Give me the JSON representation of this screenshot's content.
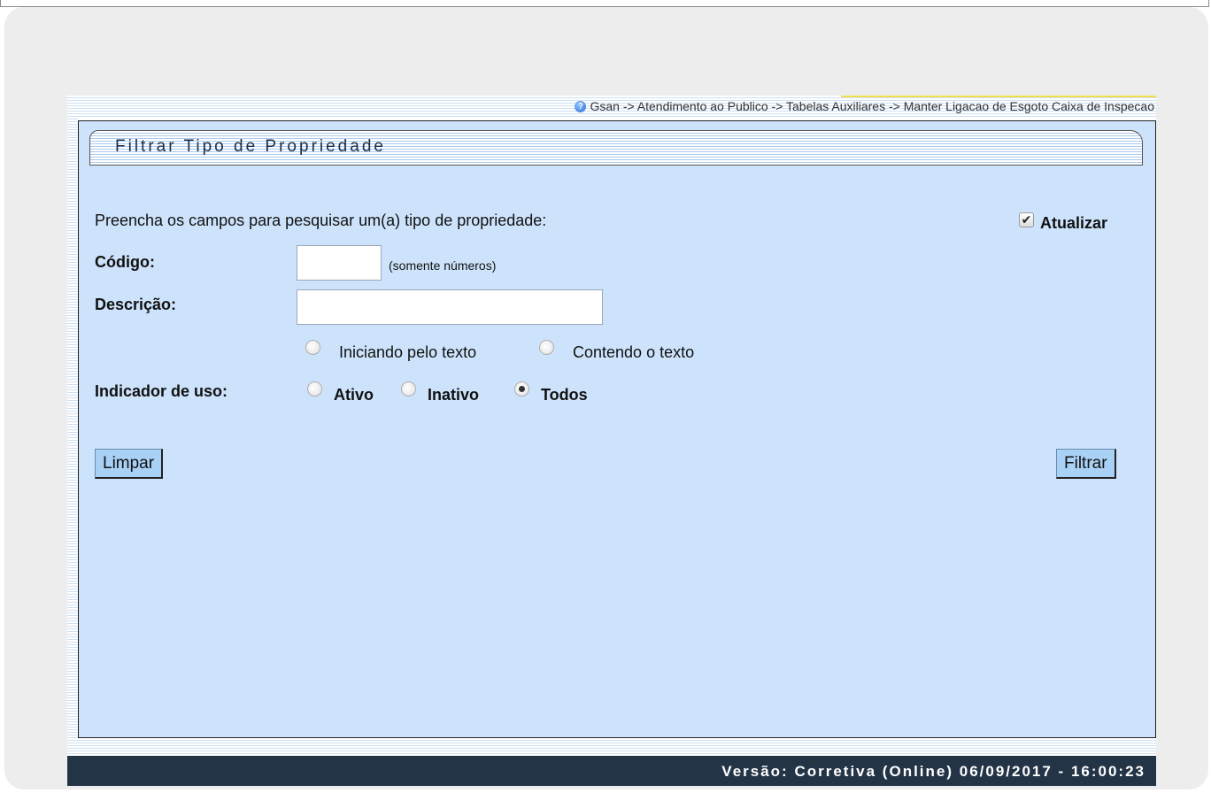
{
  "breadcrumb": "Gsan -> Atendimento ao Publico -> Tabelas Auxiliares -> Manter Ligacao de Esgoto Caixa de Inspecao",
  "page_title": "Filtrar Tipo de Propriedade",
  "instructions": "Preencha os campos para pesquisar um(a) tipo de propriedade:",
  "atualizar": {
    "label": "Atualizar",
    "checked": true
  },
  "codigo": {
    "label": "Código:",
    "value": "",
    "hint": "(somente números)"
  },
  "descricao": {
    "label": "Descrição:",
    "value": "",
    "options": [
      "Iniciando pelo texto",
      "Contendo o texto"
    ]
  },
  "indicador_uso": {
    "label": "Indicador de uso:",
    "options": [
      "Ativo",
      "Inativo",
      "Todos"
    ],
    "selected": "Todos"
  },
  "buttons": {
    "limpar": "Limpar",
    "filtrar": "Filtrar"
  },
  "footer": "Versão: Corretiva (Online) 06/09/2017 - 16:00:23",
  "icons": {
    "help": "help-icon"
  },
  "colors": {
    "panel_bg": "#cde3fb",
    "button_bg": "#a9d0f5",
    "footer_bg": "#243447",
    "card_bg": "#ededed"
  }
}
